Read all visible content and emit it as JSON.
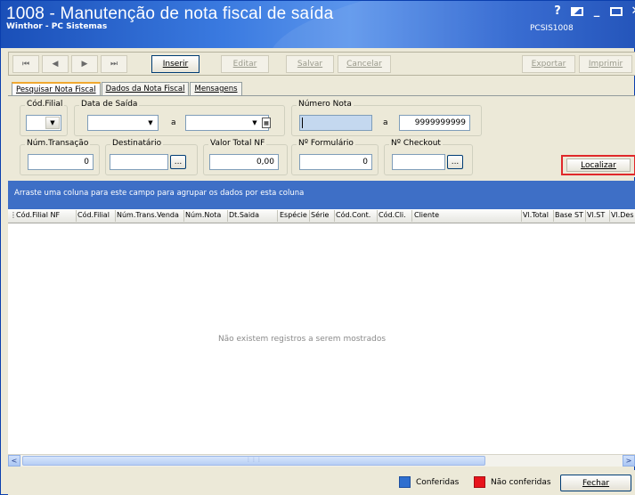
{
  "window": {
    "title": "1008 - Manutenção de nota fiscal de saída",
    "subtitle": "Winthor - PC Sistemas",
    "code": "PCSIS1008",
    "controls": {
      "help": "?",
      "minimize": "_",
      "close": "✕"
    }
  },
  "toolbar": {
    "first": "⏮",
    "prev": "◀",
    "next": "▶",
    "last": "⏭",
    "insert": "Inserir",
    "edit": "Editar",
    "save": "Salvar",
    "cancel": "Cancelar",
    "export": "Exportar",
    "print": "Imprimir"
  },
  "tabs": [
    {
      "label": "Pesquisar Nota Fiscal",
      "active": true
    },
    {
      "label": "Dados da Nota Fiscal",
      "active": false
    },
    {
      "label": "Mensagens",
      "active": false
    }
  ],
  "filters": {
    "cod_filial": {
      "label": "Cód.Filial",
      "value": ""
    },
    "data_saida": {
      "label": "Data de Saída",
      "from": "",
      "between": "a",
      "to": ""
    },
    "numero_nota": {
      "label": "Número Nota",
      "from": "",
      "between": "a",
      "to": "9999999999"
    },
    "num_transacao": {
      "label": "Núm.Transação",
      "value": "0"
    },
    "destinatario": {
      "label": "Destinatário",
      "value": "",
      "button": "..."
    },
    "valor_total_nf": {
      "label": "Valor Total NF",
      "value": "0,00"
    },
    "num_formulario": {
      "label": "Nº Formulário",
      "value": "0"
    },
    "num_checkout": {
      "label": "Nº Checkout",
      "value": "",
      "button": "..."
    }
  },
  "localizar_button": "Localizar",
  "grid": {
    "group_hint": "Arraste uma coluna para este campo para agrupar os dados por esta coluna",
    "columns": [
      "Cód.Filial NF",
      "Cód.Filial",
      "Núm.Trans.Venda",
      "Núm.Nota",
      "Dt.Saida",
      "Espécie",
      "Série",
      "Cód.Cont.",
      "Cód.Cli.",
      "Cliente",
      "Vl.Total",
      "Base ST",
      "Vl.ST",
      "Vl.Des"
    ],
    "empty_message": "Não existem registros a serem mostrados",
    "scroll_left": "<",
    "scroll_right": ">"
  },
  "legend": [
    {
      "label": "Conferidas",
      "color": "#2f6fcf"
    },
    {
      "label": "Não conferidas",
      "color": "#e8141c"
    }
  ],
  "close_button": "Fechar"
}
